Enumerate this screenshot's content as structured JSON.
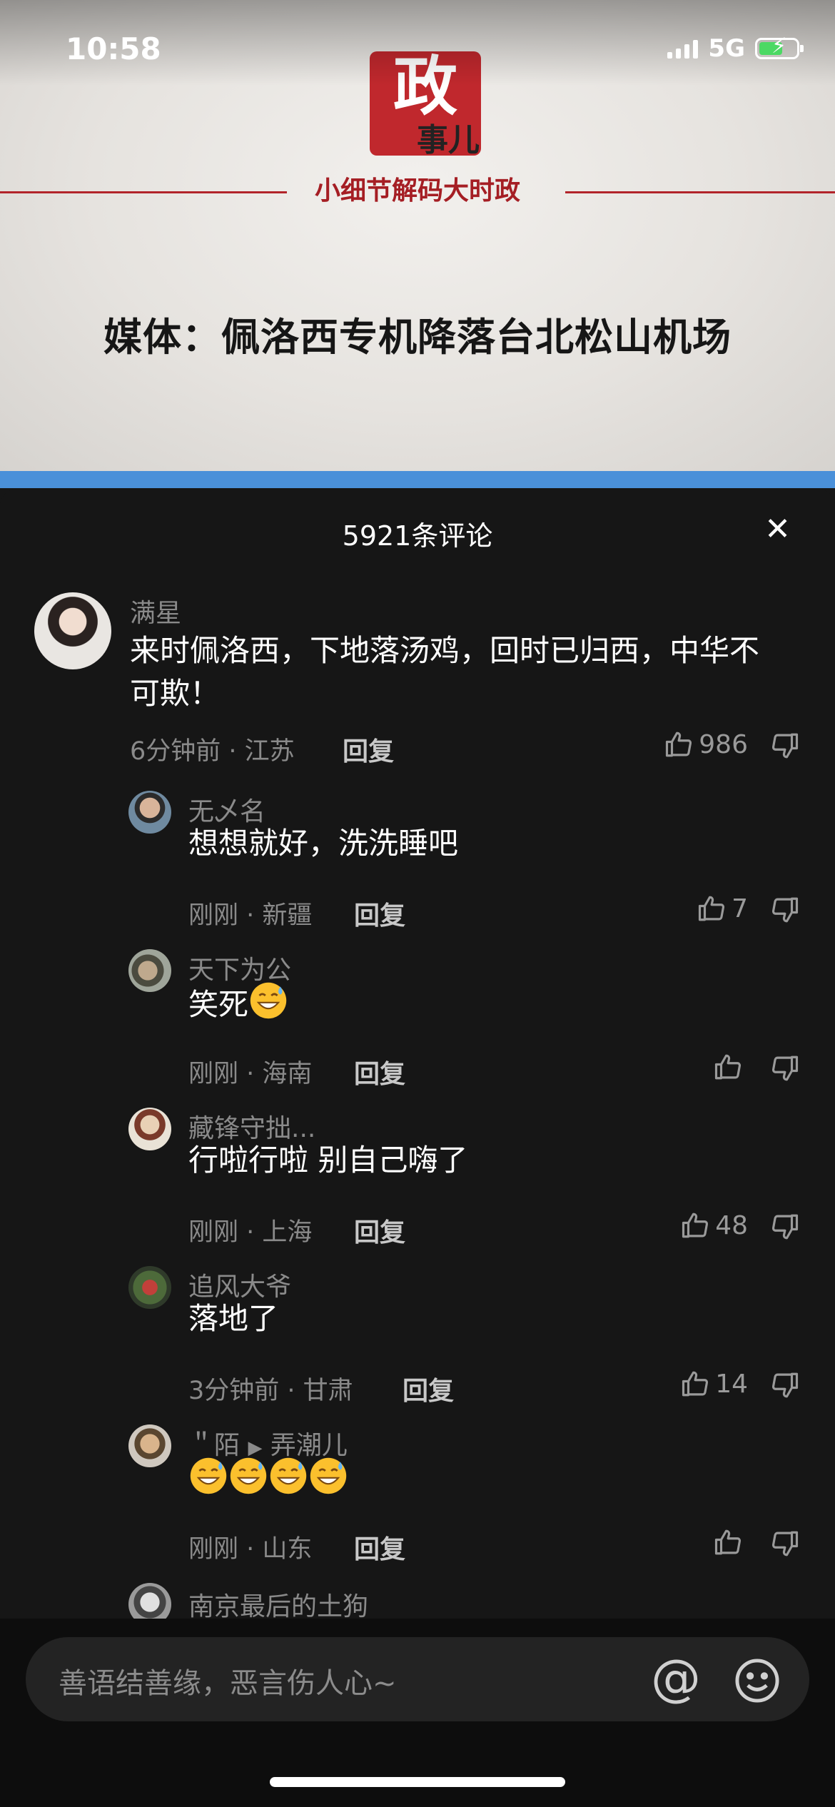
{
  "status_bar": {
    "time": "10:58",
    "network": "5G"
  },
  "video": {
    "logo_big": "政",
    "logo_small": "事儿",
    "tagline": "小细节解码大时政",
    "headline": "媒体：佩洛西专机降落台北松山机场"
  },
  "comments_panel": {
    "title": "5921条评论",
    "close_icon": "close-icon",
    "reply_label": "回复",
    "comments": [
      {
        "user": "满星",
        "text": "来时佩洛西，下地落汤鸡，回时已归西，中华不可欺！",
        "time": "6分钟前",
        "location": "江苏",
        "likes": "986",
        "is_reply": false
      },
      {
        "user": "无乄名",
        "text": "想想就好，洗洗睡吧",
        "time": "刚刚",
        "location": "新疆",
        "likes": "7",
        "is_reply": true
      },
      {
        "user": "天下为公",
        "text": "笑死",
        "time": "刚刚",
        "location": "海南",
        "likes": "",
        "is_reply": true,
        "emoji": "grin-sweat-emoji"
      },
      {
        "user": "藏锋守拙...",
        "text": "行啦行啦 别自己嗨了",
        "time": "刚刚",
        "location": "上海",
        "likes": "48",
        "is_reply": true
      },
      {
        "user": "追风大爷",
        "text": "落地了",
        "time": "3分钟前",
        "location": "甘肃",
        "likes": "14",
        "is_reply": true
      },
      {
        "user": "＂陌",
        "reply_to": "弄潮儿",
        "text": "",
        "time": "刚刚",
        "location": "山东",
        "likes": "",
        "is_reply": true,
        "emoji_count": 4
      },
      {
        "user": "南京最后的土狗",
        "is_reply": true
      }
    ]
  },
  "input_bar": {
    "placeholder": "善语结善缘，恶言伤人心~",
    "at_icon": "at-icon",
    "emoji_icon": "smile-icon"
  },
  "colors": {
    "accent_red": "#c0282d",
    "panel_bg": "#161616",
    "muted_text": "#8a8a8a"
  }
}
